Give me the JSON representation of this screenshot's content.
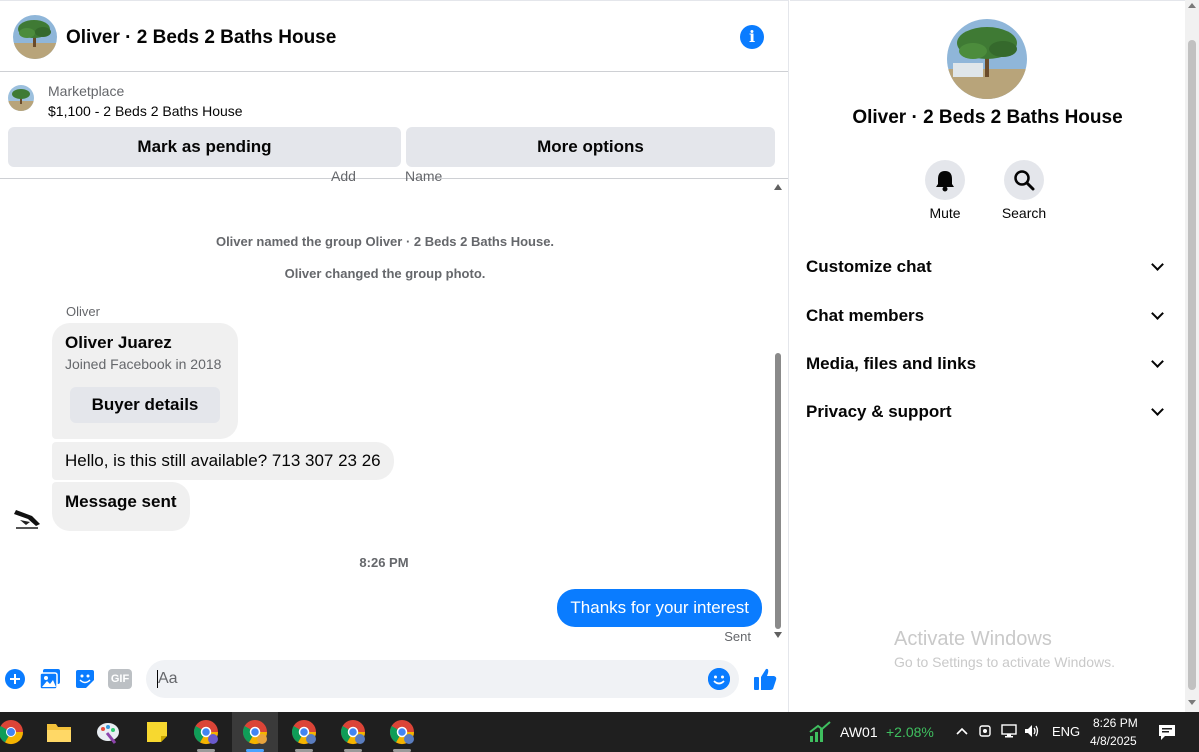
{
  "header": {
    "title": "Oliver · 2 Beds 2 Baths House",
    "info_icon": "i"
  },
  "listing": {
    "source": "Marketplace",
    "price_title": "$1,100 - 2 Beds 2 Baths House",
    "pending_button": "Mark as pending",
    "more_button": "More options"
  },
  "partial": {
    "left": "Add",
    "right": "Name"
  },
  "thread": {
    "system_messages": [
      "Oliver named the group Oliver · 2 Beds 2 Baths House.",
      "Oliver changed the group photo."
    ],
    "sender_label": "Oliver",
    "card": {
      "name": "Oliver Juarez",
      "subtitle": "Joined Facebook in 2018",
      "button": "Buyer details"
    },
    "incoming": [
      "Hello, is this still available? 713 307 23 26",
      "Message sent"
    ],
    "timestamp": "8:26 PM",
    "outgoing": "Thanks for your interest",
    "status": "Sent"
  },
  "composer": {
    "placeholder": "Aa",
    "gif_label": "GIF"
  },
  "panel": {
    "title": "Oliver · 2 Beds 2 Baths House",
    "actions": [
      {
        "label": "Mute",
        "icon": "bell-icon"
      },
      {
        "label": "Search",
        "icon": "search-icon"
      }
    ],
    "menu": [
      "Customize chat",
      "Chat members",
      "Media, files and links",
      "Privacy & support"
    ]
  },
  "watermark": {
    "line1": "Activate Windows",
    "line2": "Go to Settings to activate Windows."
  },
  "taskbar": {
    "stock_name": "AW01",
    "stock_change": "+2.08%",
    "language": "ENG",
    "time": "8:26 PM",
    "date": "4/8/2025"
  },
  "colors": {
    "accent": "#0a7cff",
    "bubble_in": "#f0f0f0",
    "button_grey": "#e4e6eb",
    "taskbar": "#1f1f1f",
    "stock_up": "#3fbf5f"
  }
}
